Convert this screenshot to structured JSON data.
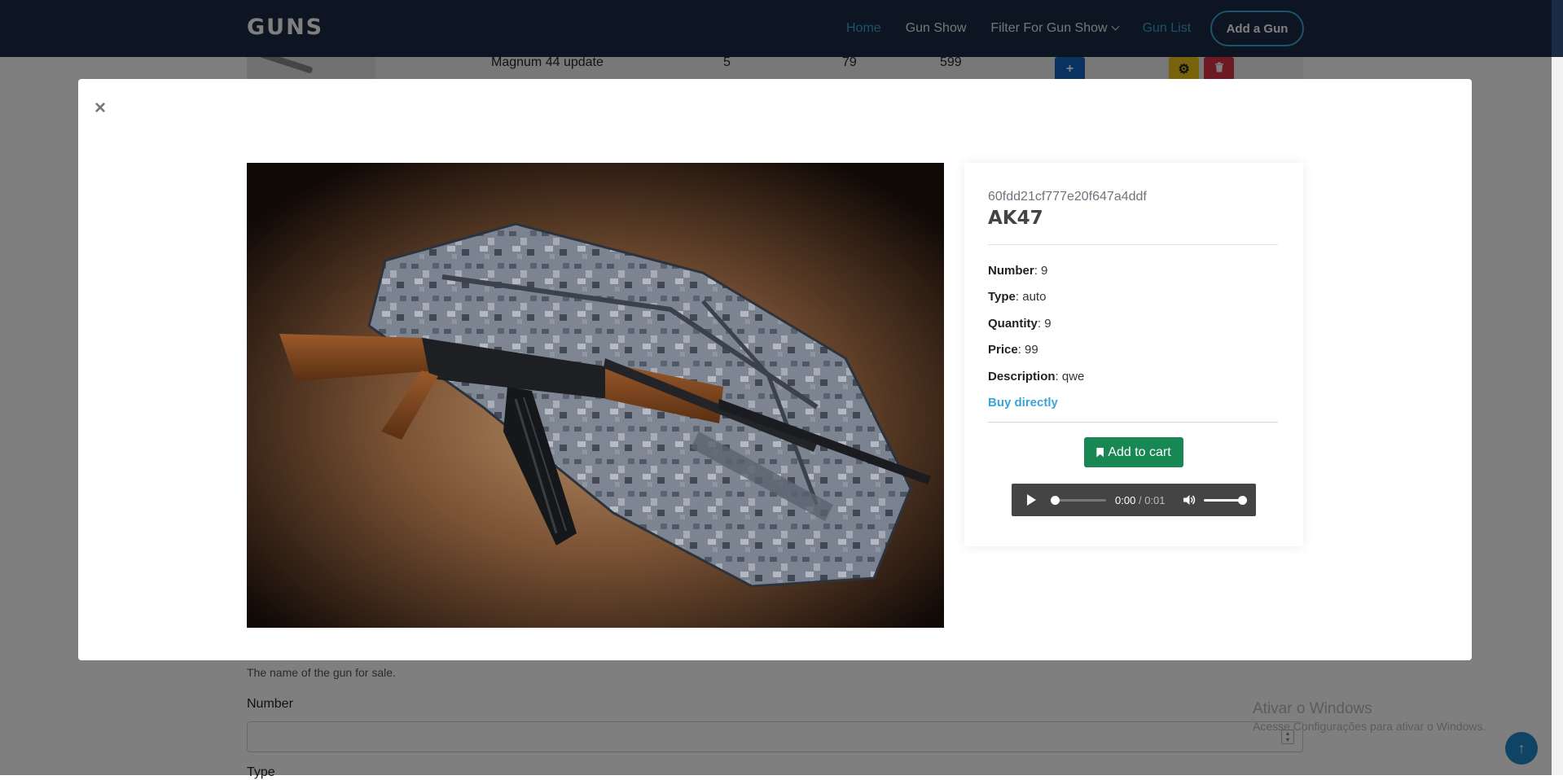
{
  "navbar": {
    "brand": "GUNS",
    "links": [
      {
        "label": "Home"
      },
      {
        "label": "Gun Show"
      },
      {
        "label": "Filter For Gun Show"
      },
      {
        "label": "Gun List"
      }
    ],
    "add_button": "Add a Gun"
  },
  "background": {
    "row": {
      "name": "Magnum 44 update",
      "number": "5",
      "quantity": "79",
      "price": "599"
    },
    "help_text": "The name of the gun for sale.",
    "number_label": "Number",
    "type_label": "Type",
    "watermark_title": "Ativar o Windows",
    "watermark_sub": "Acesse Configurações para ativar o Windows."
  },
  "modal": {
    "close_symbol": "×",
    "gun": {
      "id": "60fdd21cf777e20f647a4ddf",
      "name": "AK47",
      "fields": [
        {
          "label": "Number",
          "value": "9"
        },
        {
          "label": "Type",
          "value": "auto"
        },
        {
          "label": "Quantity",
          "value": "9"
        },
        {
          "label": "Price",
          "value": "99"
        },
        {
          "label": "Description",
          "value": "qwe"
        }
      ]
    },
    "buy_link": "Buy directly",
    "cart_button": "Add to cart",
    "audio": {
      "current": "0:00",
      "separator": "/",
      "duration": "0:01"
    }
  },
  "colors": {
    "navbar": "#1b2b45",
    "accent": "#3aa5d6",
    "cart": "#198754",
    "add_blue": "#1565c0",
    "edit_yellow": "#f0c419",
    "delete_red": "#dc3545"
  }
}
